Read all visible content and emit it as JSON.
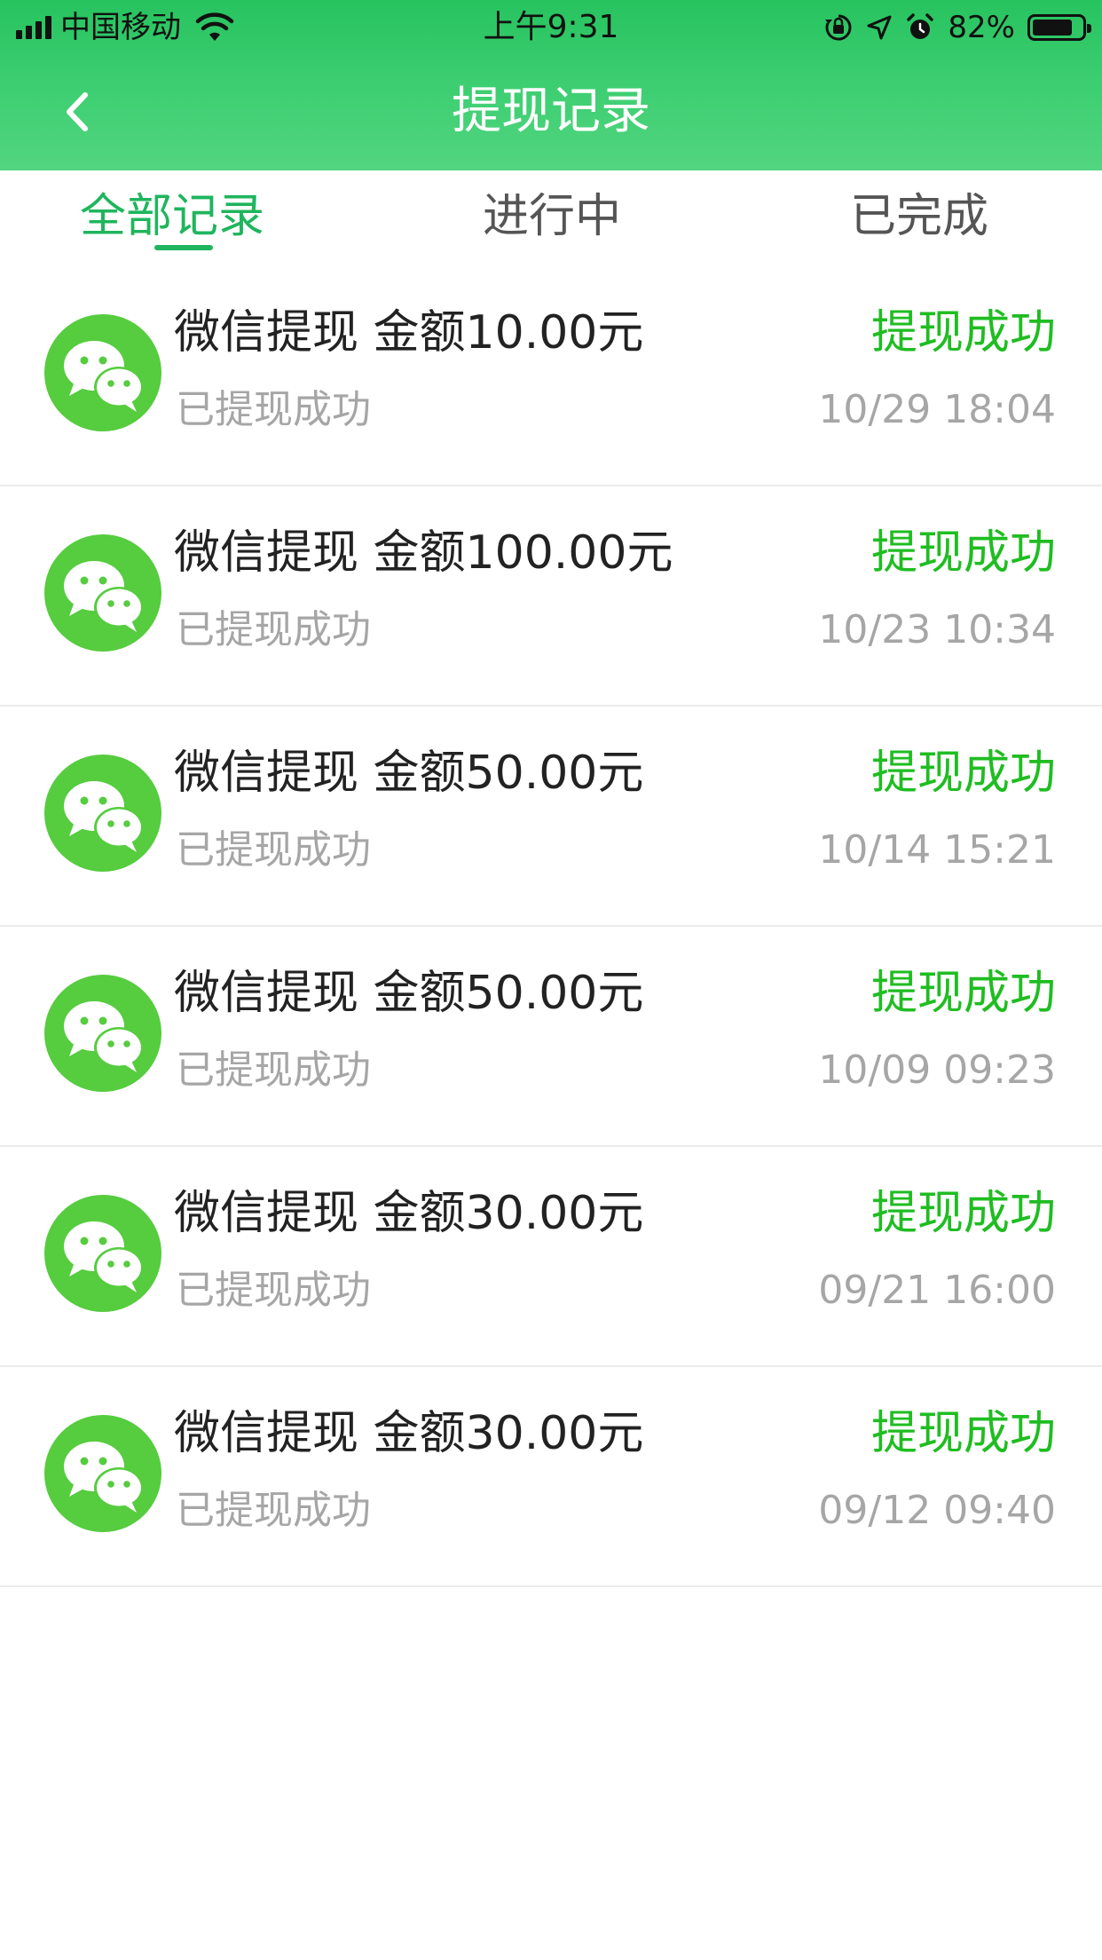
{
  "status_bar": {
    "carrier": "中国移动",
    "time": "上午9:31",
    "battery_percent": "82%",
    "battery_level": 0.82
  },
  "nav": {
    "title": "提现记录",
    "back_icon": "chevron-left-icon"
  },
  "tabs": [
    {
      "label": "全部记录",
      "active": true
    },
    {
      "label": "进行中",
      "active": false
    },
    {
      "label": "已完成",
      "active": false
    }
  ],
  "records": [
    {
      "title": "微信提现  金额10.00元",
      "subtitle": "已提现成功",
      "status": "提现成功",
      "time": "10/29 18:04"
    },
    {
      "title": "微信提现  金额100.00元",
      "subtitle": "已提现成功",
      "status": "提现成功",
      "time": "10/23 10:34"
    },
    {
      "title": "微信提现  金额50.00元",
      "subtitle": "已提现成功",
      "status": "提现成功",
      "time": "10/14 15:21"
    },
    {
      "title": "微信提现  金额50.00元",
      "subtitle": "已提现成功",
      "status": "提现成功",
      "time": "10/09 09:23"
    },
    {
      "title": "微信提现  金额30.00元",
      "subtitle": "已提现成功",
      "status": "提现成功",
      "time": "09/21 16:00"
    },
    {
      "title": "微信提现  金额30.00元",
      "subtitle": "已提现成功",
      "status": "提现成功",
      "time": "09/12 09:40"
    }
  ],
  "colors": {
    "header_green": "#3fcf73",
    "tab_active": "#1fb55d",
    "status_green": "#1fbd21",
    "wechat_green": "#56cc3f"
  }
}
